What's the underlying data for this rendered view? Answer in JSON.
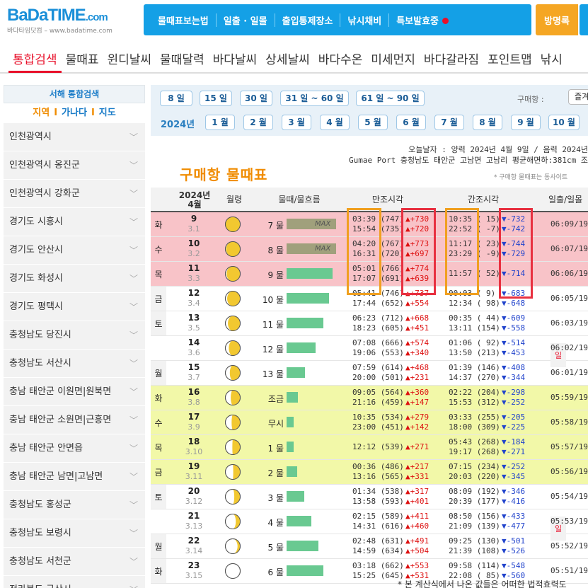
{
  "logo": {
    "brand_ba": "BaDa",
    "brand_time": "TIME",
    "brand_com": ".com",
    "subtitle": "바다타임닷컴 – www.badatime.com"
  },
  "topnav": {
    "items": [
      "물때표보는법",
      "일출 · 일몰",
      "출입통제장소",
      "낚시채비",
      "특보발효중"
    ],
    "guestbook": "방명록"
  },
  "menu_tabs": [
    "통합검색",
    "물때표",
    "윈디날씨",
    "물때달력",
    "바다날씨",
    "상세날씨",
    "바다수온",
    "미세먼지",
    "바다갈라짐",
    "포인트맵",
    "낚시"
  ],
  "sidebar": {
    "title": "서해 통합검색",
    "filters": [
      "지역",
      "가나다",
      "지도"
    ],
    "regions": [
      "인천광역시",
      "인천광역시 옹진군",
      "인천광역시 강화군",
      "경기도 시흥시",
      "경기도 안산시",
      "경기도 화성시",
      "경기도 평택시",
      "충청남도 당진시",
      "충청남도 서산시",
      "충남 태안군 이원면|원북면",
      "충남 태안군 소원면|근흥면",
      "충남 태안군 안면읍",
      "충남 태안군 남면|고남면",
      "충청남도 홍성군",
      "충청남도 보령시",
      "충청남도 서천군",
      "전라북도 군산시"
    ]
  },
  "filter": {
    "day_ranges": [
      "8 일",
      "15 일",
      "30 일",
      "31 일 ~ 60 일",
      "61 일 ~ 90 일"
    ],
    "buy_label": "구매항 :",
    "select_value": "즐겨",
    "year_label": "2024년",
    "months": [
      "1 월",
      "2 월",
      "3 월",
      "4 월",
      "5 월",
      "6 월",
      "7 월",
      "8 월",
      "9 월",
      "10 월"
    ]
  },
  "today": {
    "line1": "오늘날자 : 양력 2024년 4월 9일 / 음력 2024년",
    "line2": "Gumae Port 충청남도 태안군 고남면 고남리 평균해면하:381cm 조"
  },
  "page_title": "구매항 물때표",
  "note": "* 구매항 물때표는 동사이트",
  "table_header": {
    "month": "2024년\n4월",
    "moon": "월령",
    "tide": "물때/물흐름",
    "high": "만조시각",
    "low": "간조시각",
    "sun": "일출/일몰"
  },
  "rows": [
    {
      "dow": "화",
      "day": "9",
      "lunar": "3.1",
      "moon": 0.02,
      "tide": "7 물",
      "bar": 70,
      "max": "MAX",
      "hi1": "03:39 (747)",
      "hi1d": "▲+730",
      "hi2": "15:54 (735)",
      "hi2d": "▲+720",
      "lo1": "10:35 ( 15)",
      "lo1d": "▼-732",
      "lo2": "22:52 ( -7)",
      "lo2d": "▼-742",
      "sun": "06:09/19:"
    },
    {
      "dow": "수",
      "day": "10",
      "lunar": "3.2",
      "moon": 0.05,
      "tide": "8 물",
      "bar": 70,
      "max": "MAX",
      "hi1": "04:20 (767)",
      "hi1d": "▲+773",
      "hi2": "16:31 (720)",
      "hi2d": "▲+697",
      "lo1": "11:17 ( 23)",
      "lo1d": "▼-744",
      "lo2": "23:29 ( -9)",
      "lo2d": "▼-729",
      "sun": "06:07/19:"
    },
    {
      "dow": "목",
      "day": "11",
      "lunar": "3.3",
      "moon": 0.08,
      "tide": "9 물",
      "bar": 65,
      "max": "",
      "hi1": "05:01 (766)",
      "hi1d": "▲+774",
      "hi2": "17:07 (691)",
      "hi2d": "▲+639",
      "lo1": "11:57 ( 52)",
      "lo1d": "▼-714",
      "lo2": "",
      "lo2d": "",
      "sun": "06:06/19:"
    },
    {
      "dow": "금",
      "day": "12",
      "lunar": "3.4",
      "moon": 0.12,
      "tide": "10 물",
      "bar": 60,
      "max": "",
      "hi1": "05:41 (746)",
      "hi1d": "▲+737",
      "hi2": "17:44 (652)",
      "hi2d": "▲+554",
      "lo1": "00:03 ( 9)",
      "lo1d": "▼-683",
      "lo2": "12:34 ( 98)",
      "lo2d": "▼-648",
      "sun": "06:05/19:"
    },
    {
      "dow": "토",
      "day": "13",
      "lunar": "3.5",
      "moon": 0.17,
      "tide": "11 물",
      "bar": 52,
      "max": "",
      "hi1": "06:23 (712)",
      "hi1d": "▲+668",
      "hi2": "18:23 (605)",
      "hi2d": "▲+451",
      "lo1": "00:35 ( 44)",
      "lo1d": "▼-609",
      "lo2": "13:11 (154)",
      "lo2d": "▼-558",
      "sun": "06:03/19:"
    },
    {
      "dow": "일",
      "day": "14",
      "lunar": "3.6",
      "moon": 0.23,
      "tide": "12 물",
      "bar": 41,
      "max": "",
      "hi1": "07:08 (666)",
      "hi1d": "▲+574",
      "hi2": "19:06 (553)",
      "hi2d": "▲+340",
      "lo1": "01:06 ( 92)",
      "lo1d": "▼-514",
      "lo2": "13:50 (213)",
      "lo2d": "▼-453",
      "sun": "06:02/19:"
    },
    {
      "dow": "월",
      "day": "15",
      "lunar": "3.7",
      "moon": 0.3,
      "tide": "13 물",
      "bar": 26,
      "max": "",
      "hi1": "07:59 (614)",
      "hi1d": "▲+468",
      "hi2": "20:00 (501)",
      "hi2d": "▲+231",
      "lo1": "01:39 (146)",
      "lo1d": "▼-408",
      "lo2": "14:37 (270)",
      "lo2d": "▼-344",
      "sun": "06:01/19:"
    },
    {
      "dow": "화",
      "day": "16",
      "lunar": "3.8",
      "moon": 0.36,
      "tide": "조금",
      "bar": 16,
      "max": "",
      "hi1": "09:05 (564)",
      "hi1d": "▲+360",
      "hi2": "21:16 (459)",
      "hi2d": "▲+147",
      "lo1": "02:22 (204)",
      "lo1d": "▼-298",
      "lo2": "15:53 (312)",
      "lo2d": "▼-252",
      "sun": "05:59/19:"
    },
    {
      "dow": "수",
      "day": "17",
      "lunar": "3.9",
      "moon": 0.42,
      "tide": "무시",
      "bar": 10,
      "max": "",
      "hi1": "10:35 (534)",
      "hi1d": "▲+279",
      "hi2": "23:00 (451)",
      "hi2d": "▲+142",
      "lo1": "03:33 (255)",
      "lo1d": "▼-205",
      "lo2": "18:00 (309)",
      "lo2d": "▼-225",
      "sun": "05:58/19:"
    },
    {
      "dow": "목",
      "day": "18",
      "lunar": "3.10",
      "moon": 0.47,
      "tide": "1 물",
      "bar": 10,
      "max": "",
      "hi1": "12:12 (539)",
      "hi1d": "▲+271",
      "hi2": "",
      "hi2d": "",
      "lo1": "05:43 (268)",
      "lo1d": "▼-184",
      "lo2": "19:17 (268)",
      "lo2d": "▼-271",
      "sun": "05:57/19:"
    },
    {
      "dow": "금",
      "day": "19",
      "lunar": "3.11",
      "moon": 0.53,
      "tide": "2 물",
      "bar": 15,
      "max": "",
      "hi1": "00:36 (486)",
      "hi1d": "▲+217",
      "hi2": "13:16 (565)",
      "hi2d": "▲+331",
      "lo1": "07:15 (234)",
      "lo1d": "▼-252",
      "lo2": "20:03 (220)",
      "lo2d": "▼-345",
      "sun": "05:56/19:"
    },
    {
      "dow": "토",
      "day": "20",
      "lunar": "3.12",
      "moon": 0.6,
      "tide": "3 물",
      "bar": 25,
      "max": "",
      "hi1": "01:34 (538)",
      "hi1d": "▲+317",
      "hi2": "13:58 (593)",
      "hi2d": "▲+401",
      "lo1": "08:09 (192)",
      "lo1d": "▼-346",
      "lo2": "20:39 (177)",
      "lo2d": "▼-416",
      "sun": "05:54/19:"
    },
    {
      "dow": "일",
      "day": "21",
      "lunar": "3.13",
      "moon": 0.7,
      "tide": "4 물",
      "bar": 35,
      "max": "",
      "hi1": "02:15 (589)",
      "hi1d": "▲+411",
      "hi2": "14:31 (616)",
      "hi2d": "▲+460",
      "lo1": "08:50 (156)",
      "lo1d": "▼-433",
      "lo2": "21:09 (139)",
      "lo2d": "▼-477",
      "sun": "05:53/19:"
    },
    {
      "dow": "월",
      "day": "22",
      "lunar": "3.14",
      "moon": 0.82,
      "tide": "5 물",
      "bar": 45,
      "max": "",
      "hi1": "02:48 (631)",
      "hi1d": "▲+491",
      "hi2": "14:59 (634)",
      "hi2d": "▲+504",
      "lo1": "09:25 (130)",
      "lo1d": "▼-501",
      "lo2": "21:39 (108)",
      "lo2d": "▼-526",
      "sun": "05:52/19:"
    },
    {
      "dow": "화",
      "day": "23",
      "lunar": "3.15",
      "moon": 1.0,
      "tide": "6 물",
      "bar": 52,
      "max": "",
      "hi1": "03:18 (662)",
      "hi1d": "▲+553",
      "hi2": "15:25 (645)",
      "hi2d": "▲+531",
      "lo1": "09:58 (114)",
      "lo1d": "▼-548",
      "lo2": "22:08 ( 85)",
      "lo2d": "▼-560",
      "sun": "05:51/19:"
    }
  ],
  "footnote": "* 본 계산식에서 나온 값들은 어떠한 법적효력도",
  "colors": {
    "accent": "#14a0e6",
    "highlight_red": "#f8c3c8",
    "highlight_yellow": "#f2f8a8",
    "box_orange": "#f0a020",
    "box_red": "#e83040"
  }
}
